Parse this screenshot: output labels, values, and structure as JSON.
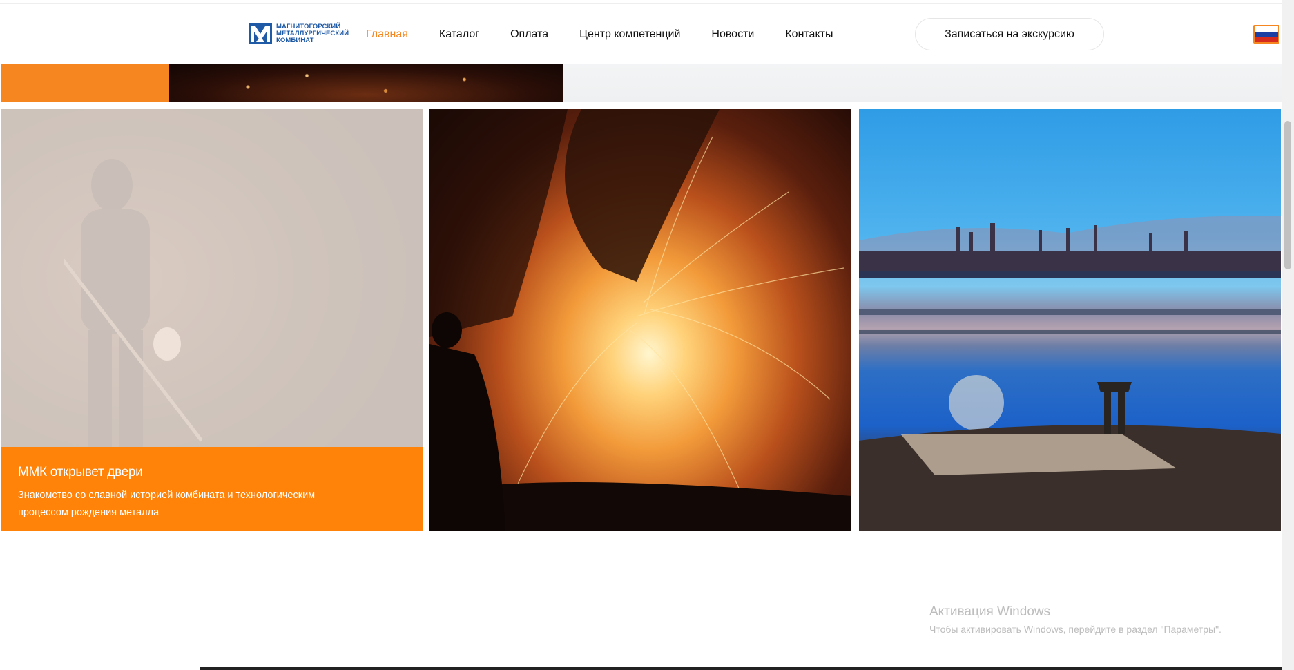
{
  "header": {
    "logo_text": [
      "МАГНИТОГОРСКИЙ",
      "МЕТАЛЛУРГИЧЕСКИЙ",
      "КОМБИНАТ"
    ],
    "nav": [
      {
        "label": "Главная",
        "active": true
      },
      {
        "label": "Каталог",
        "active": false
      },
      {
        "label": "Оплата",
        "active": false
      },
      {
        "label": "Центр компетенций",
        "active": false
      },
      {
        "label": "Новости",
        "active": false
      },
      {
        "label": "Контакты",
        "active": false
      }
    ],
    "cta_label": "Записаться на экскурсию",
    "language_flag": "russian-flag-icon",
    "accent_color": "#f6861f"
  },
  "tiles": [
    {
      "title": "ММК открывет двери",
      "description": "Знакомство со славной историей комбината и технологическим процессом рождения металла",
      "image": "steelworker-photo"
    },
    {
      "image": "molten-steel-sparks-photo"
    },
    {
      "image": "magnitogorsk-night-panorama-photo"
    }
  ],
  "watermark": {
    "title": "Активация Windows",
    "subtitle": "Чтобы активировать Windows, перейдите в раздел \"Параметры\"."
  }
}
